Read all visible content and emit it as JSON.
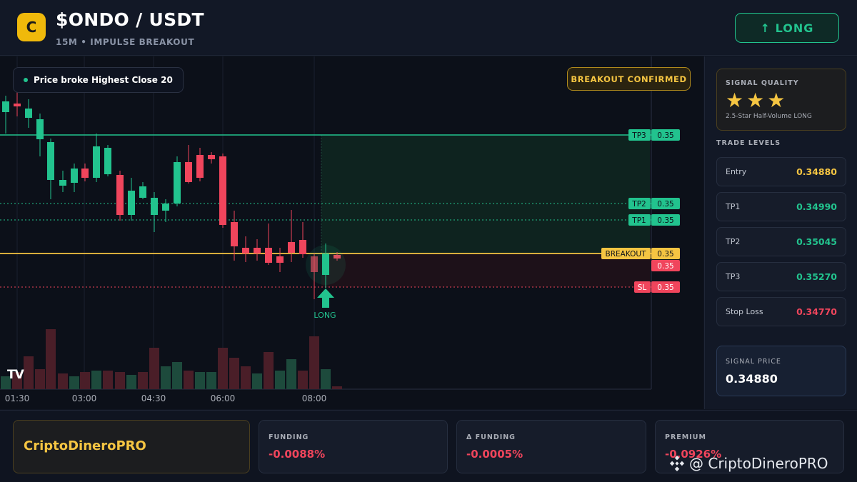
{
  "header": {
    "logo_letter": "C",
    "pair": "$ONDO / USDT",
    "subtitle": "15M • IMPULSE BREAKOUT",
    "action_label": "↑ LONG"
  },
  "chart": {
    "note": "Price broke Highest Close 20",
    "confirm_badge": "BREAKOUT CONFIRMED",
    "tv_logo": "TV",
    "time_labels": [
      "01:30",
      "03:00",
      "04:30",
      "06:00",
      "08:00"
    ],
    "levels": [
      {
        "tag": "TP3",
        "value": "0.35"
      },
      {
        "tag": "TP2",
        "value": "0.35"
      },
      {
        "tag": "TP1",
        "value": "0.35"
      },
      {
        "tag": "BREAKOUT",
        "value": "0.35"
      },
      {
        "tag": "",
        "value": "0.35"
      },
      {
        "tag": "SL",
        "value": "0.35"
      }
    ],
    "signal_marker_label": "LONG",
    "colors": {
      "up": "#22c38e",
      "down": "#f0455c",
      "breakout": "#f5c542"
    }
  },
  "side": {
    "quality_title": "SIGNAL QUALITY",
    "stars": "★★★",
    "quality_desc": "2.5-Star Half-Volume LONG",
    "levels_title": "TRADE LEVELS",
    "levels": [
      {
        "label": "Entry",
        "value": "0.34880",
        "color": "#f5c542"
      },
      {
        "label": "TP1",
        "value": "0.34990",
        "color": "#22c38e"
      },
      {
        "label": "TP2",
        "value": "0.35045",
        "color": "#22c38e"
      },
      {
        "label": "TP3",
        "value": "0.35270",
        "color": "#22c38e"
      },
      {
        "label": "Stop Loss",
        "value": "0.34770",
        "color": "#f0455c"
      }
    ],
    "signal_price_title": "SIGNAL PRICE",
    "signal_price": "0.34880"
  },
  "footer": {
    "brand": "CriptoDineroPRO",
    "stats": [
      {
        "title": "FUNDING",
        "value": "-0.0088%"
      },
      {
        "title": "Δ FUNDING",
        "value": "-0.0005%"
      },
      {
        "title": "PREMIUM",
        "value": "-0.0926%"
      }
    ],
    "watermark": "@ CriptoDineroPRO"
  }
}
